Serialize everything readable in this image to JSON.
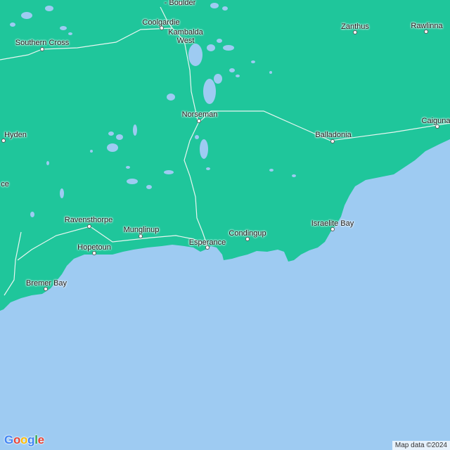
{
  "colors": {
    "land": "#1fc69b",
    "water": "#9ecbf2",
    "lake": "#9ecbf2",
    "road": "#e8f6f1"
  },
  "places": [
    {
      "id": "kalgoorlie",
      "name": "Kalgoorlie\n- Boulder"
    },
    {
      "id": "coolgardie",
      "name": "Coolgardie"
    },
    {
      "id": "kambalda-west",
      "name": "Kambalda\nWest"
    },
    {
      "id": "southern-cross",
      "name": "Southern Cross"
    },
    {
      "id": "zanthus",
      "name": "Zanthus"
    },
    {
      "id": "rawlinna",
      "name": "Rawlinna"
    },
    {
      "id": "norseman",
      "name": "Norseman"
    },
    {
      "id": "balladonia",
      "name": "Balladonia"
    },
    {
      "id": "caiguna",
      "name": "Caiguna"
    },
    {
      "id": "hyden",
      "name": "Hyden"
    },
    {
      "id": "lake-grace",
      "name": "ce"
    },
    {
      "id": "ravensthorpe",
      "name": "Ravensthorpe"
    },
    {
      "id": "munglinup",
      "name": "Munglinup"
    },
    {
      "id": "hopetoun",
      "name": "Hopetoun"
    },
    {
      "id": "esperance",
      "name": "Esperance"
    },
    {
      "id": "condingup",
      "name": "Condingup"
    },
    {
      "id": "israelite-bay",
      "name": "Israelite Bay"
    },
    {
      "id": "bremer-bay",
      "name": "Bremer Bay"
    }
  ],
  "logo": {
    "g1": "G",
    "o1": "o",
    "o2": "o",
    "g2": "g",
    "l": "l",
    "e": "e"
  },
  "attribution": "Map data ©2024"
}
